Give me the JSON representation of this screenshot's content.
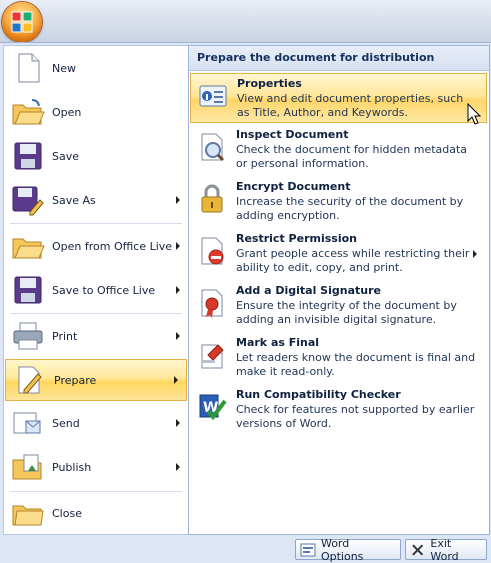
{
  "window": {
    "title_bar_text": ""
  },
  "left_menu": {
    "items": [
      {
        "label": "New",
        "icon": "new-document-icon",
        "has_arrow": false
      },
      {
        "label": "Open",
        "icon": "open-folder-icon",
        "has_arrow": false
      },
      {
        "label": "Save",
        "icon": "save-disk-icon",
        "has_arrow": false
      },
      {
        "label": "Save As",
        "icon": "save-as-icon",
        "has_arrow": true
      },
      {
        "label": "Open from Office Live",
        "icon": "open-office-live-icon",
        "has_arrow": true
      },
      {
        "label": "Save to Office Live",
        "icon": "save-office-live-icon",
        "has_arrow": true
      },
      {
        "label": "Print",
        "icon": "printer-icon",
        "has_arrow": true
      },
      {
        "label": "Prepare",
        "icon": "prepare-icon",
        "has_arrow": true,
        "selected": true
      },
      {
        "label": "Send",
        "icon": "send-icon",
        "has_arrow": true
      },
      {
        "label": "Publish",
        "icon": "publish-icon",
        "has_arrow": true
      },
      {
        "label": "Close",
        "icon": "close-folder-icon",
        "has_arrow": false
      }
    ]
  },
  "prepare_panel": {
    "header": "Prepare the document for distribution",
    "items": [
      {
        "title": "Properties",
        "desc": "View and edit document properties, such as Title, Author, and Keywords.",
        "icon": "properties-icon",
        "selected": true
      },
      {
        "title": "Inspect Document",
        "desc": "Check the document for hidden metadata or personal information.",
        "icon": "inspect-document-icon"
      },
      {
        "title": "Encrypt Document",
        "desc": "Increase the security of the document by adding encryption.",
        "icon": "encrypt-lock-icon"
      },
      {
        "title": "Restrict Permission",
        "desc": "Grant people access while restricting their ability to edit, copy, and print.",
        "icon": "restrict-permission-icon",
        "has_arrow": true
      },
      {
        "title": "Add a Digital Signature",
        "desc": "Ensure the integrity of the document by adding an invisible digital signature.",
        "icon": "digital-signature-icon"
      },
      {
        "title": "Mark as Final",
        "desc": "Let readers know the document is final and make it read-only.",
        "icon": "mark-final-icon"
      },
      {
        "title": "Run Compatibility Checker",
        "desc": "Check for features not supported by earlier versions of Word.",
        "icon": "compatibility-checker-icon"
      }
    ]
  },
  "bottom_buttons": {
    "word_options": "Word Options",
    "exit_word": "Exit Word"
  },
  "colors": {
    "highlight": "#ffd65e",
    "frame": "#dce6f4",
    "border": "#9db4d6"
  }
}
